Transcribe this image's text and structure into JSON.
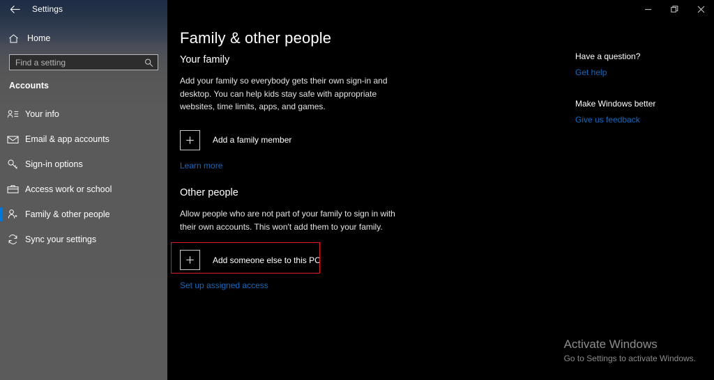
{
  "window": {
    "title": "Settings",
    "back_icon": "back-arrow-icon",
    "controls": {
      "minimize": "minimize-icon",
      "restore": "restore-icon",
      "close": "close-icon"
    }
  },
  "sidebar": {
    "home_label": "Home",
    "home_icon": "home-icon",
    "search": {
      "placeholder": "Find a setting",
      "value": "",
      "icon": "search-icon"
    },
    "section_label": "Accounts",
    "items": [
      {
        "label": "Your info",
        "icon": "user-info-icon",
        "selected": false
      },
      {
        "label": "Email & app accounts",
        "icon": "mail-icon",
        "selected": false
      },
      {
        "label": "Sign-in options",
        "icon": "key-icon",
        "selected": false
      },
      {
        "label": "Access work or school",
        "icon": "briefcase-icon",
        "selected": false
      },
      {
        "label": "Family & other people",
        "icon": "people-icon",
        "selected": true
      },
      {
        "label": "Sync your settings",
        "icon": "sync-icon",
        "selected": false
      }
    ]
  },
  "main": {
    "page_title": "Family & other people",
    "your_family": {
      "heading": "Your family",
      "description": "Add your family so everybody gets their own sign-in and desktop. You can help kids stay safe with appropriate websites, time limits, apps, and games.",
      "add_button_label": "Add a family member",
      "add_button_icon": "plus-icon",
      "learn_more_label": "Learn more"
    },
    "other_people": {
      "heading": "Other people",
      "description": "Allow people who are not part of your family to sign in with their own accounts. This won't add them to your family.",
      "add_button_label": "Add someone else to this PC",
      "add_button_icon": "plus-icon",
      "assigned_access_label": "Set up assigned access"
    }
  },
  "right_panel": {
    "question_heading": "Have a question?",
    "get_help_label": "Get help",
    "better_heading": "Make Windows better",
    "feedback_label": "Give us feedback"
  },
  "watermark": {
    "title": "Activate Windows",
    "subtitle": "Go to Settings to activate Windows."
  },
  "colors": {
    "accent_blue": "#0078d7",
    "link_blue": "#1668c0",
    "highlight_red": "#e01b24",
    "content_bg": "#000000",
    "sidebar_gray": "#5a5a5a"
  }
}
